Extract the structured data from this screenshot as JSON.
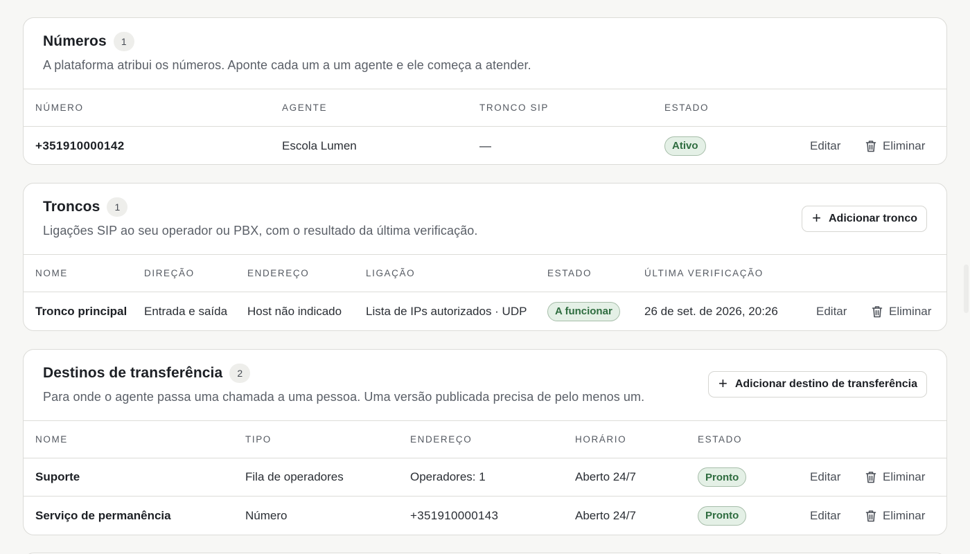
{
  "numbers": {
    "title": "Números",
    "count": "1",
    "subtitle": "A plataforma atribui os números. Aponte cada um a um agente e ele começa a atender.",
    "columns": [
      "NÚMERO",
      "AGENTE",
      "TRONCO SIP",
      "ESTADO"
    ],
    "rows": [
      {
        "numero": "+351910000142",
        "agente": "Escola Lumen",
        "tronco": "—",
        "estado": "Ativo",
        "edit": "Editar",
        "delete": "Eliminar"
      }
    ]
  },
  "trunks": {
    "title": "Troncos",
    "count": "1",
    "subtitle": "Ligações SIP ao seu operador ou PBX, com o resultado da última verificação.",
    "add_label": "Adicionar tronco",
    "columns": [
      "NOME",
      "DIREÇÃO",
      "ENDEREÇO",
      "LIGAÇÃO",
      "ESTADO",
      "ÚLTIMA VERIFICAÇÃO"
    ],
    "rows": [
      {
        "nome": "Tronco principal",
        "direcao": "Entrada e saída",
        "endereco": "Host não indicado",
        "ligacao": "Lista de IPs autorizados · UDP",
        "estado": "A funcionar",
        "verificacao": "26 de set. de 2026, 20:26",
        "edit": "Editar",
        "delete": "Eliminar"
      }
    ]
  },
  "transfers": {
    "title": "Destinos de transferência",
    "count": "2",
    "subtitle": "Para onde o agente passa uma chamada a uma pessoa. Uma versão publicada precisa de pelo menos um.",
    "add_label": "Adicionar destino de transferência",
    "columns": [
      "NOME",
      "TIPO",
      "ENDEREÇO",
      "HORÁRIO",
      "ESTADO"
    ],
    "rows": [
      {
        "nome": "Suporte",
        "tipo": "Fila de operadores",
        "endereco": "Operadores: 1",
        "horario": "Aberto 24/7",
        "estado": "Pronto",
        "edit": "Editar",
        "delete": "Eliminar"
      },
      {
        "nome": "Serviço de permanência",
        "tipo": "Número",
        "endereco": "+351910000143",
        "horario": "Aberto 24/7",
        "estado": "Pronto",
        "edit": "Editar",
        "delete": "Eliminar"
      }
    ]
  },
  "icons": {
    "trash": "trash-icon",
    "plus": "plus-icon"
  },
  "colors": {
    "status_bg": "#e4f0e6",
    "status_border": "#a6bda9",
    "status_text": "#2e6c3f"
  }
}
